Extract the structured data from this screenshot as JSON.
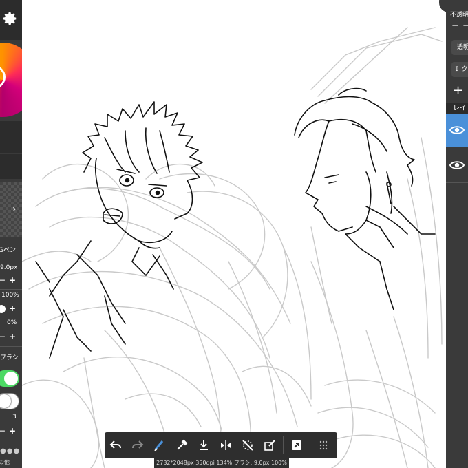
{
  "left_panel": {
    "brush_name": "Gペン",
    "brush_size": "9.0px",
    "opacity": "100%",
    "stabilizer": "0%",
    "brush_label": "ブラシ",
    "count": "3",
    "other": "の他",
    "minus": "−",
    "plus": "+"
  },
  "right_panel": {
    "opacity_label": "不透明",
    "minus": "−",
    "clear_label": "透明",
    "clip_label": "ク",
    "add_label": "+",
    "layers_label": "レイ"
  },
  "toolbar": {
    "items": [
      "undo-icon",
      "redo-icon",
      "brush-icon",
      "eyedropper-icon",
      "download-icon",
      "flip-icon",
      "snap-off-icon",
      "transform-icon",
      "share-icon",
      "grid-icon"
    ]
  },
  "status": {
    "text": "2732*2048px 350dpi 134% ブラシ: 9.0px 100%"
  },
  "colors": {
    "panel": "#3a3a3a",
    "accent": "#4a90d9",
    "toggle_on": "#4cd964"
  }
}
